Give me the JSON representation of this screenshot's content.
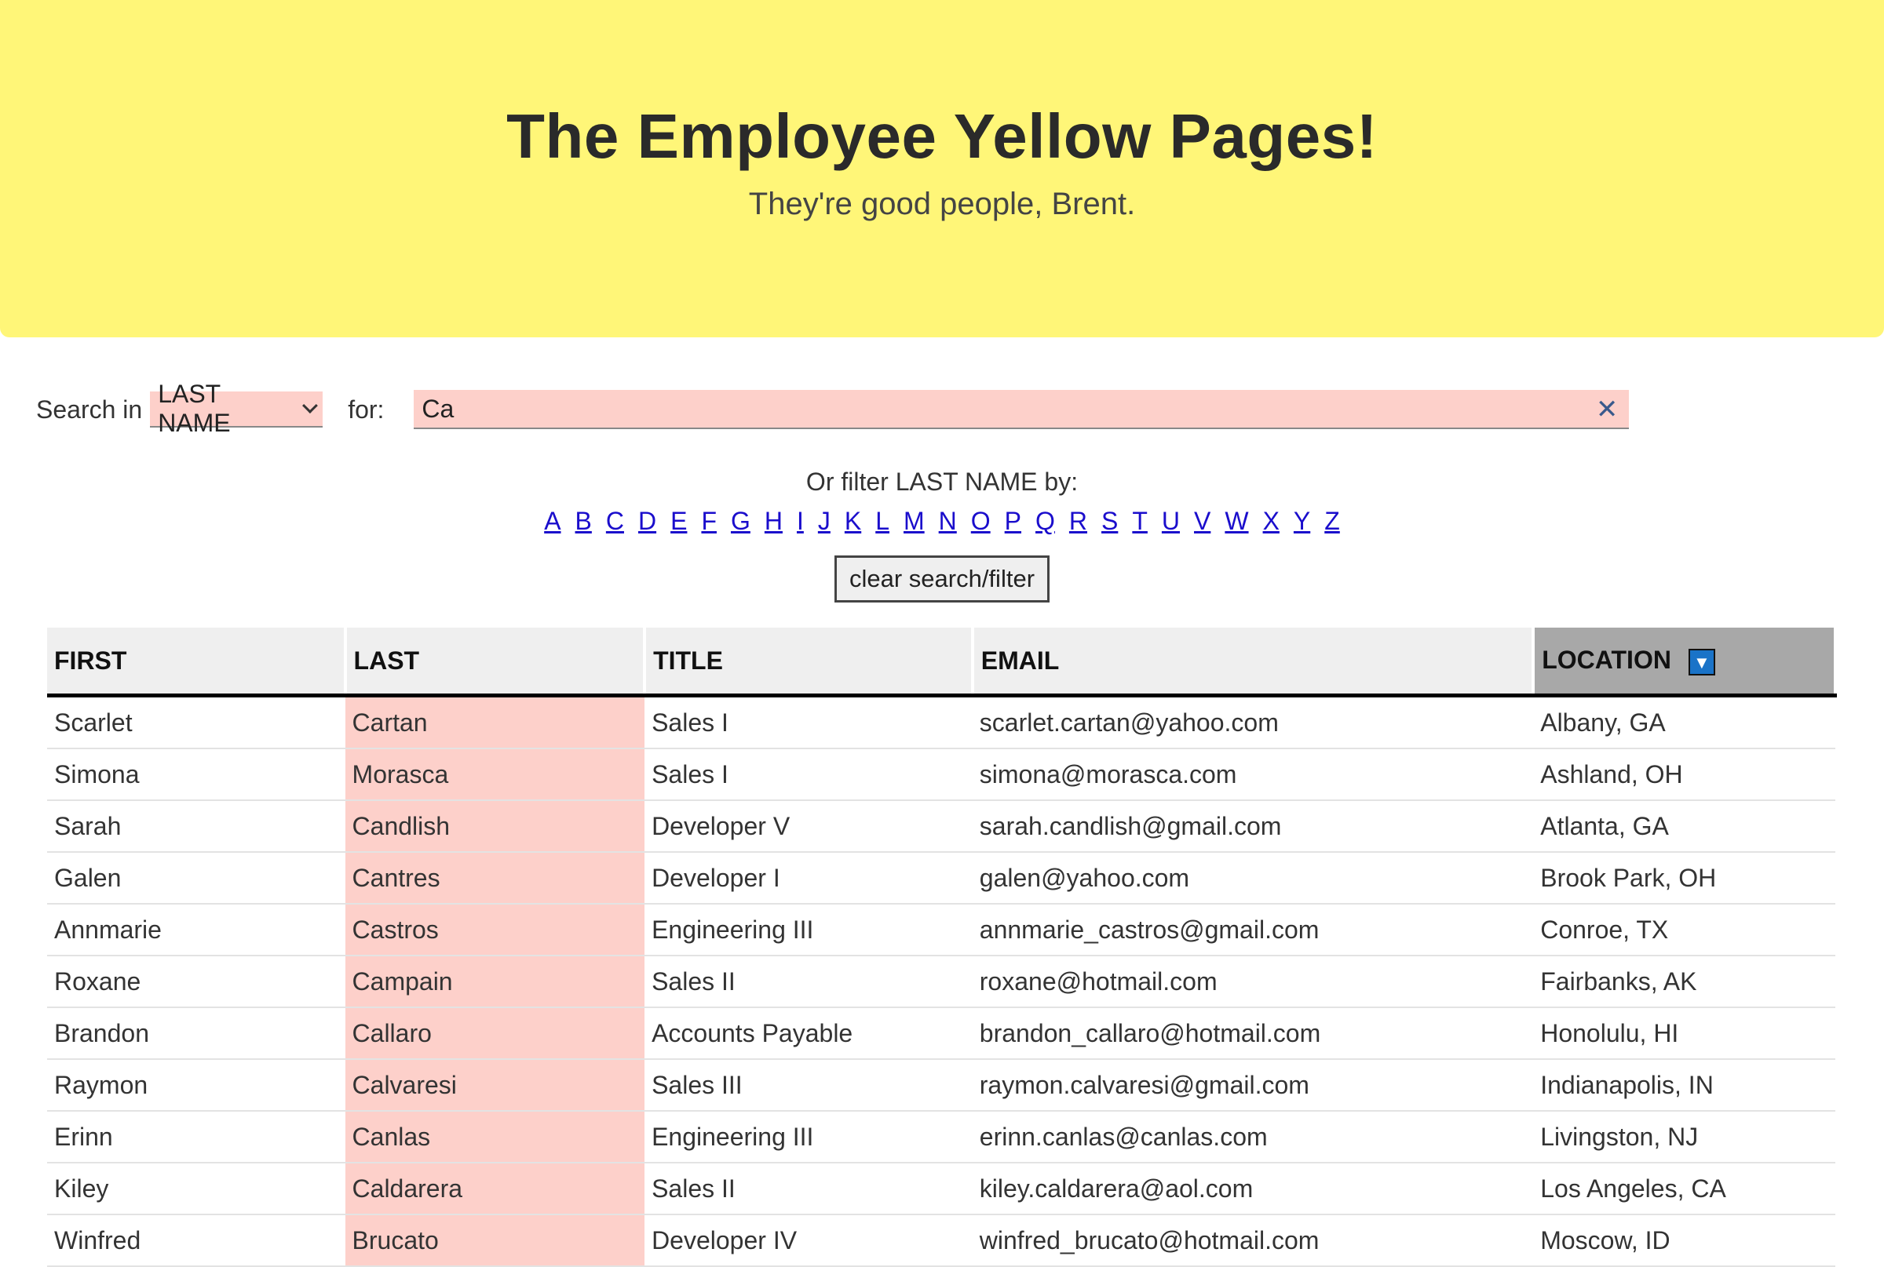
{
  "hero": {
    "title": "The Employee Yellow Pages!",
    "subtitle": "They're good people, Brent."
  },
  "search": {
    "label": "Search in",
    "field_selected": "LAST NAME",
    "for_label": "for:",
    "value": "Ca",
    "clear_glyph": "✕"
  },
  "filter": {
    "caption": "Or filter LAST NAME by:",
    "letters": [
      "A",
      "B",
      "C",
      "D",
      "E",
      "F",
      "G",
      "H",
      "I",
      "J",
      "K",
      "L",
      "M",
      "N",
      "O",
      "P",
      "Q",
      "R",
      "S",
      "T",
      "U",
      "V",
      "W",
      "X",
      "Y",
      "Z"
    ],
    "clear_button": "clear search/filter"
  },
  "table": {
    "headers": [
      "FIRST",
      "LAST",
      "TITLE",
      "EMAIL",
      "LOCATION"
    ],
    "sort_column": "LOCATION",
    "sort_glyph": "▼",
    "highlight_color": "#fdd0ca",
    "rows": [
      [
        "Scarlet",
        "Cartan",
        "Sales I",
        "scarlet.cartan@yahoo.com",
        "Albany, GA"
      ],
      [
        "Simona",
        "Morasca",
        "Sales I",
        "simona@morasca.com",
        "Ashland, OH"
      ],
      [
        "Sarah",
        "Candlish",
        "Developer V",
        "sarah.candlish@gmail.com",
        "Atlanta, GA"
      ],
      [
        "Galen",
        "Cantres",
        "Developer I",
        "galen@yahoo.com",
        "Brook Park, OH"
      ],
      [
        "Annmarie",
        "Castros",
        "Engineering III",
        "annmarie_castros@gmail.com",
        "Conroe, TX"
      ],
      [
        "Roxane",
        "Campain",
        "Sales II",
        "roxane@hotmail.com",
        "Fairbanks, AK"
      ],
      [
        "Brandon",
        "Callaro",
        "Accounts Payable",
        "brandon_callaro@hotmail.com",
        "Honolulu, HI"
      ],
      [
        "Raymon",
        "Calvaresi",
        "Sales III",
        "raymon.calvaresi@gmail.com",
        "Indianapolis, IN"
      ],
      [
        "Erinn",
        "Canlas",
        "Engineering III",
        "erinn.canlas@canlas.com",
        "Livingston, NJ"
      ],
      [
        "Kiley",
        "Caldarera",
        "Sales II",
        "kiley.caldarera@aol.com",
        "Los Angeles, CA"
      ],
      [
        "Winfred",
        "Brucato",
        "Developer IV",
        "winfred_brucato@hotmail.com",
        "Moscow, ID"
      ]
    ]
  },
  "colors": {
    "hero_bg": "#fff678",
    "input_bg": "#fdd0ca",
    "link": "#1a0dcc",
    "sort_button": "#1a73c8"
  }
}
